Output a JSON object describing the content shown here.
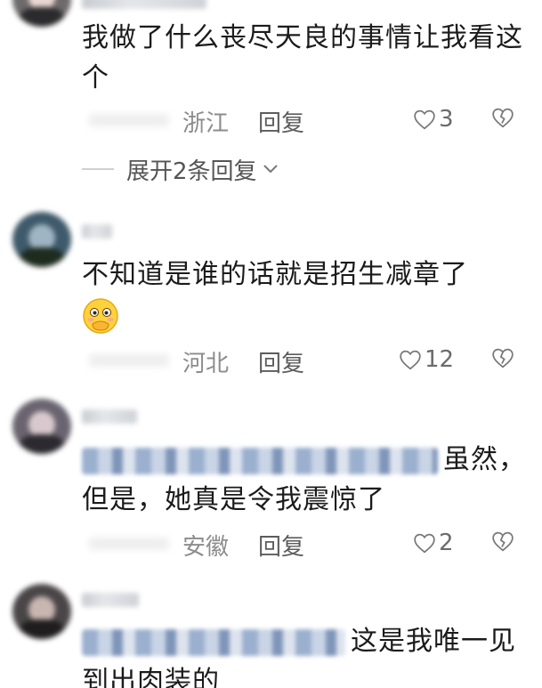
{
  "comments": [
    {
      "text": "我做了什么丧尽天良的事情让我看这个",
      "location": "浙江",
      "reply_label": "回复",
      "likes": "3",
      "expand_label": "展开2条回复",
      "avatar_colors": [
        "#6e6a6c",
        "#e9d8d2",
        "#2b2a2c"
      ]
    },
    {
      "text": "不知道是谁的话就是招生减章了",
      "emoji": "face-with-hand-over-mouth",
      "location": "河北",
      "reply_label": "回复",
      "likes": "12",
      "avatar_colors": [
        "#3f5a6b",
        "#9fb5c3",
        "#1e2b1f"
      ]
    },
    {
      "text_tail": "虽然，但是，她真是令我震惊了",
      "location": "安徽",
      "reply_label": "回复",
      "likes": "2",
      "avatar_colors": [
        "#6a6470",
        "#d9c9cf",
        "#2c2a30"
      ]
    },
    {
      "text_tail": "这是我唯一见到出肉装的",
      "avatar_colors": [
        "#4a4648",
        "#c8b6b0",
        "#1f1d1e"
      ]
    }
  ],
  "colors": {
    "text": "#1b1b1b",
    "meta": "#8c8c8c",
    "mention": "#5b7bb0"
  }
}
